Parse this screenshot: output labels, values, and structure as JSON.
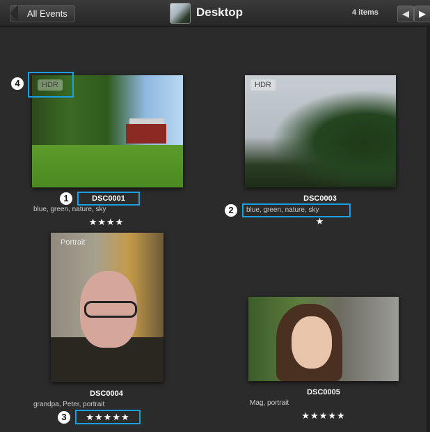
{
  "toolbar": {
    "back_label": "All Events",
    "title": "Desktop",
    "count": "4 items",
    "prev_icon": "◀",
    "next_icon": "▶"
  },
  "photos": [
    {
      "badge": "HDR",
      "name": "DSC0001",
      "tags": "blue, green, nature, sky",
      "stars": "★★★★",
      "rating": 4
    },
    {
      "badge": "HDR",
      "name": "DSC0003",
      "tags": "blue, green, nature, sky",
      "stars": "★",
      "rating": 1
    },
    {
      "badge": "Portrait",
      "name": "DSC0004",
      "tags": "grandpa, Peter, portrait",
      "stars": "★★★★★",
      "rating": 5
    },
    {
      "badge": "",
      "name": "DSC0005",
      "tags": "Mag, portrait",
      "stars": "★★★★★",
      "rating": 5
    }
  ],
  "callouts": [
    "1",
    "2",
    "3",
    "4"
  ],
  "colors": {
    "highlight": "#1b9fe0",
    "background": "#2b2b2b"
  }
}
